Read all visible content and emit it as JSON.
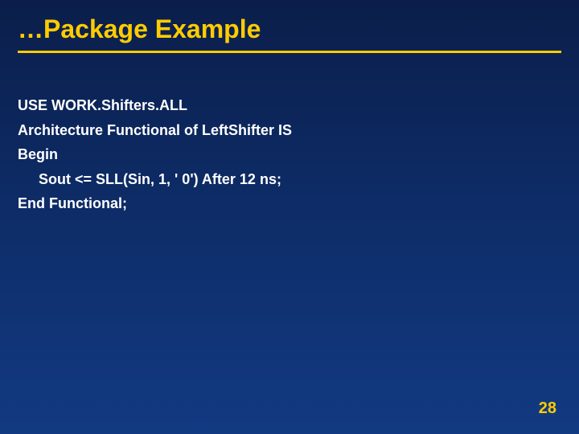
{
  "title": "…Package Example",
  "lines": {
    "l1": "USE WORK.Shifters.ALL",
    "l2": "Architecture Functional of LeftShifter IS",
    "l3": "Begin",
    "l4": "Sout <= SLL(Sin, 1, ' 0') After 12 ns;",
    "l5": "End Functional;"
  },
  "page": "28"
}
